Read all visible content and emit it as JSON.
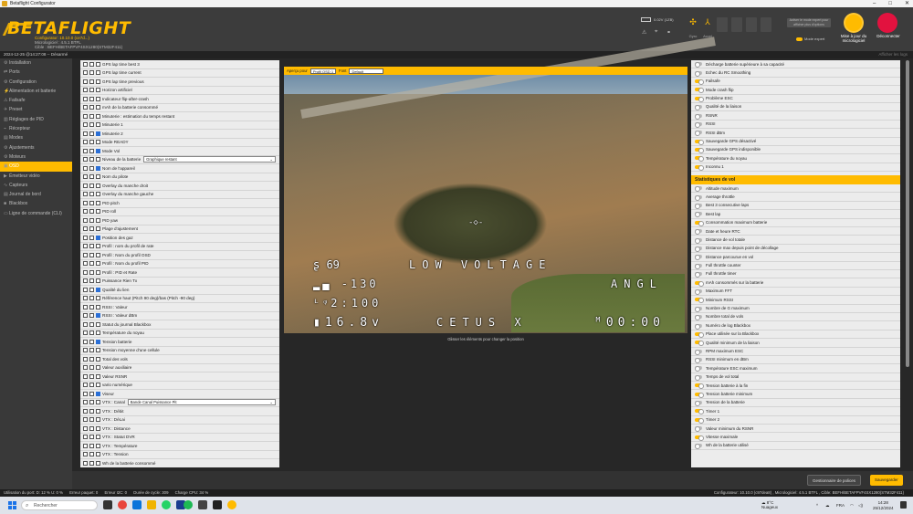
{
  "window": {
    "title": "Betaflight Configurator",
    "controls": [
      "–",
      "□",
      "✕"
    ]
  },
  "header": {
    "logo": "BETAFLIGHT",
    "tagline": [
      "Configurator: 10.10.0 (ce7d...)",
      "Micrologiciel : 4.5.1 BTFL",
      "Cible : BEFH/BETAFPVF4SX1280(STM32F411)"
    ],
    "battery_text": "0.02V (1ZB)",
    "sensors": [
      "Gyro",
      "Accel",
      "Mag",
      "Baro",
      "GPS",
      "Sonar"
    ],
    "expert_box": "Activer le mode expert pour afficher plus d'options",
    "expert_mode": "Mode expert",
    "firmware_button": "Mise à jour du micrologiciel",
    "disconnect_button": "Déconnecter"
  },
  "status_top": {
    "left": "2024-12-25 @14:27:08 -- Désarmé",
    "right": "Afficher les logs"
  },
  "sidebar": {
    "items": [
      {
        "icon": "⚙",
        "label": "Installation"
      },
      {
        "icon": "⇄",
        "label": "Ports"
      },
      {
        "icon": "⚙",
        "label": "Configuration"
      },
      {
        "icon": "⚡",
        "label": "Alimentation et batterie"
      },
      {
        "icon": "⚠",
        "label": "Failsafe"
      },
      {
        "icon": "✈",
        "label": "Preset"
      },
      {
        "icon": "▥",
        "label": "Réglages de PID"
      },
      {
        "icon": "⌁",
        "label": "Récepteur"
      },
      {
        "icon": "▤",
        "label": "Modes"
      },
      {
        "icon": "⚙",
        "label": "Ajustements"
      },
      {
        "icon": "⚙",
        "label": "Moteurs"
      },
      {
        "icon": "▣",
        "label": "OSD"
      },
      {
        "icon": "▶",
        "label": "Émetteur vidéo"
      },
      {
        "icon": "∿",
        "label": "Capteurs"
      },
      {
        "icon": "▤",
        "label": "Journal de bord"
      },
      {
        "icon": "■",
        "label": "Blackbox"
      },
      {
        "icon": "▭",
        "label": "Ligne de commande (CLI)"
      }
    ],
    "active_index": 11
  },
  "elements": [
    {
      "label": "GPS lap time best 3",
      "checked": false
    },
    {
      "label": "GPS lap time current",
      "checked": false
    },
    {
      "label": "GPS lap time previous",
      "checked": false
    },
    {
      "label": "Horizon artificiel",
      "checked": false
    },
    {
      "label": "Indicateur flip-after-crash",
      "checked": false
    },
    {
      "label": "mAh de la batterie consommé",
      "checked": false
    },
    {
      "label": "Minuterie : estimation du temps restant",
      "checked": false
    },
    {
      "label": "Minuterie 1",
      "checked": false
    },
    {
      "label": "Minuterie 2",
      "checked": true
    },
    {
      "label": "Mode READY",
      "checked": false
    },
    {
      "label": "Mode Vol",
      "checked": true
    },
    {
      "label": "Niveau de la batterie",
      "checked": false,
      "select": "Graphique restant"
    },
    {
      "label": "Nom de l'appareil",
      "checked": true
    },
    {
      "label": "Nom du pilote",
      "checked": false
    },
    {
      "label": "Overlay du manche droit",
      "checked": false
    },
    {
      "label": "Overlay du manche gauche",
      "checked": false
    },
    {
      "label": "PID pitch",
      "checked": false
    },
    {
      "label": "PID roll",
      "checked": false
    },
    {
      "label": "PID yaw",
      "checked": false
    },
    {
      "label": "Plage d'ajustement",
      "checked": false
    },
    {
      "label": "Position des gaz",
      "checked": true
    },
    {
      "label": "Profil : nom du profil de rate",
      "checked": false
    },
    {
      "label": "Profil : Nom du profil OSD",
      "checked": false
    },
    {
      "label": "Profil : Nom du profil PID",
      "checked": false
    },
    {
      "label": "Profil : PID et Rate",
      "checked": false
    },
    {
      "label": "Puissance Rien Tx",
      "checked": false
    },
    {
      "label": "Qualité du lien",
      "checked": true
    },
    {
      "label": "Référence haut (Pitch 90 deg)/bas (Pitch -90 deg)",
      "checked": false
    },
    {
      "label": "RSSI : Valeur",
      "checked": false
    },
    {
      "label": "RSSI : Valeur dBm",
      "checked": true
    },
    {
      "label": "Statut du journal Blackbox",
      "checked": false
    },
    {
      "label": "Température du noyau",
      "checked": false
    },
    {
      "label": "Tension batterie",
      "checked": true
    },
    {
      "label": "Tension moyenne d'une cellule",
      "checked": false
    },
    {
      "label": "Total des vols",
      "checked": false
    },
    {
      "label": "Valeur auxiliaire",
      "checked": false
    },
    {
      "label": "Valeur RSNR",
      "checked": false
    },
    {
      "label": "vario numérique",
      "checked": false
    },
    {
      "label": "Viseur",
      "checked": true
    },
    {
      "label": "VTX : Canal",
      "checked": false,
      "select": "Bande Canal Puissance Pit"
    },
    {
      "label": "VTX : Débit",
      "checked": false
    },
    {
      "label": "VTX : DéLai",
      "checked": false
    },
    {
      "label": "VTX : Distance",
      "checked": false
    },
    {
      "label": "VTX : Statut DVR",
      "checked": false
    },
    {
      "label": "VTX : Température",
      "checked": false
    },
    {
      "label": "VTX : Tension",
      "checked": false
    },
    {
      "label": "Wh de la batterie consommé",
      "checked": false
    }
  ],
  "preview": {
    "toolbar_label": "Aperçu pour",
    "profile_select": "Profil OSD 1",
    "font_label": "Font",
    "font_select": "Default",
    "osd": {
      "throttle": "69",
      "warning": "LOW VOLTAGE",
      "rssi": "-130",
      "mode": "ANGL",
      "lq": "2:100",
      "voltage": "16.8v",
      "craft": "CETUS X",
      "timer": "00:00"
    },
    "caption": "Glisser les éléments pour changer la position"
  },
  "warnings": [
    {
      "label": "Décharge batterie supérieure à sa capacité",
      "on": false
    },
    {
      "label": "Echec du RC Smoothing",
      "on": false
    },
    {
      "label": "Failsafe",
      "on": true
    },
    {
      "label": "Mode crash flip",
      "on": true
    },
    {
      "label": "Problème ESC",
      "on": true
    },
    {
      "label": "Qualité de la liaison",
      "on": false
    },
    {
      "label": "RSNR",
      "on": false
    },
    {
      "label": "RSSI",
      "on": false
    },
    {
      "label": "RSSI dBm",
      "on": false
    },
    {
      "label": "Sauvegarde GPS désactivé",
      "on": true
    },
    {
      "label": "Sauvegarde GPS indisponible",
      "on": true
    },
    {
      "label": "Température du noyau",
      "on": true
    },
    {
      "label": "Inconnu 1",
      "on": true
    }
  ],
  "stats_header": "Statistiques de vol",
  "stats": [
    {
      "label": "Altitude maximum",
      "on": false
    },
    {
      "label": "Average throttle",
      "on": false
    },
    {
      "label": "Best 3 consecutive laps",
      "on": false
    },
    {
      "label": "Best lap",
      "on": false
    },
    {
      "label": "Consommation maximum batterie",
      "on": true
    },
    {
      "label": "Date et heure RTC",
      "on": false
    },
    {
      "label": "Distance de vol totale",
      "on": false
    },
    {
      "label": "Distance max depuis point de décollage",
      "on": false
    },
    {
      "label": "Distance parcourue en vol",
      "on": false
    },
    {
      "label": "Full throttle counter",
      "on": false
    },
    {
      "label": "Full throttle timer",
      "on": false
    },
    {
      "label": "mAh consommés sur la batterie",
      "on": true
    },
    {
      "label": "Maximum FFT",
      "on": false
    },
    {
      "label": "Minimum RSSI",
      "on": true
    },
    {
      "label": "Nombre de G maximum",
      "on": false
    },
    {
      "label": "Nombre total de vols",
      "on": false
    },
    {
      "label": "Numéro de log Blackbox",
      "on": false
    },
    {
      "label": "Place utilisée sur la Blackbox",
      "on": true
    },
    {
      "label": "Qualité minimum de la liaison",
      "on": true
    },
    {
      "label": "RPM maximum ESC",
      "on": false
    },
    {
      "label": "RSSI minimum en dBm",
      "on": false
    },
    {
      "label": "Température ESC maximum",
      "on": false
    },
    {
      "label": "Temps de vol total",
      "on": false
    },
    {
      "label": "Tension batterie à la fin",
      "on": true
    },
    {
      "label": "Tension batterie minimum",
      "on": true
    },
    {
      "label": "Tension de la batterie",
      "on": false
    },
    {
      "label": "Timer 1",
      "on": true
    },
    {
      "label": "Timer 2",
      "on": true
    },
    {
      "label": "Valeur minimum du RSNR",
      "on": false
    },
    {
      "label": "Vitesse maximale",
      "on": true
    },
    {
      "label": "Wh de la batterie utilisé",
      "on": false
    }
  ],
  "buttons": {
    "fonts": "Gestionnaire de polices",
    "save": "Sauvegarder"
  },
  "status_bottom": {
    "items": [
      "Utilisation du port: D: 12 % U: 0 %",
      "Erreur paquet: 0",
      "Erreur I2C: 0",
      "Durée de cycle: 309",
      "Charge CPU: 34 %"
    ],
    "right": "Configurateur: 10.10.0 (c97dea8) , Micrologiciel: 4.5.1 BTFL , Cible: BEFH/BETAFPVF4SX1280(STM32F411)"
  },
  "taskbar": {
    "search": "Rechercher",
    "weather_temp": "8°C",
    "weather_text": "Nuageux",
    "lang": "FRA",
    "time": "14:28",
    "date": "25/12/2024"
  },
  "colors": {
    "accent": "#ffbb00",
    "disconnect": "#e2123f",
    "checkbox": "#2b6fd6"
  }
}
